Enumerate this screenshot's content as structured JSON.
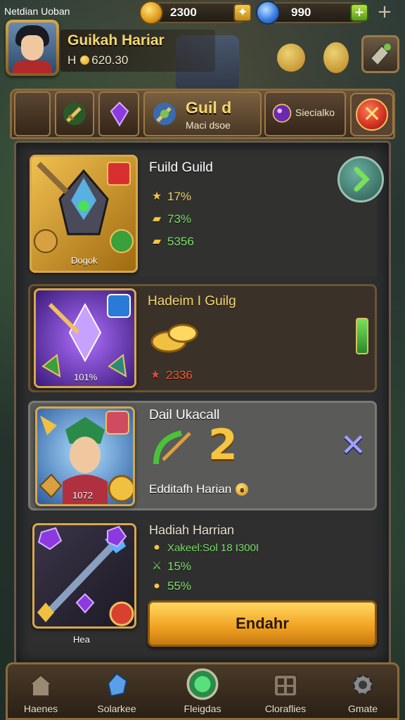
{
  "status_bar": {
    "title": "Netdian Uoban"
  },
  "resources": {
    "gold": {
      "value": "2300",
      "icon": "gold-coin-icon"
    },
    "gems": {
      "value": "990",
      "icon": "blue-gem-icon"
    }
  },
  "player": {
    "name": "Guikah Hariar",
    "sub_prefix": "H",
    "coins": "620.30"
  },
  "tabs": {
    "active_title": "Guil d",
    "active_subtitle": "Maci dsoe",
    "side_label": "Siecialko"
  },
  "cards": [
    {
      "title": "Fuild Guild",
      "caption": "Dogok",
      "stats": [
        "17%",
        "73%",
        "5356"
      ]
    },
    {
      "title": "Hadeim I Guilg",
      "caption": "101%",
      "stats": [
        "2336"
      ]
    },
    {
      "title": "Dail Ukacall",
      "caption": "1072",
      "footer": "Edditafh Harian"
    },
    {
      "title": "Hadiah Harrian",
      "caption": "Hea",
      "stats": [
        "Xakeel:Sol 18 I300I",
        "15%",
        "55%"
      ],
      "button": "Endahr"
    }
  ],
  "bottom_nav": [
    {
      "label": "Haenes",
      "icon": "house-icon"
    },
    {
      "label": "Solarkee",
      "icon": "crystal-icon"
    },
    {
      "label": "Fleigdas",
      "icon": "green-orb-icon"
    },
    {
      "label": "Cloraflies",
      "icon": "inventory-grid-icon"
    },
    {
      "label": "Gmate",
      "icon": "gear-icon"
    }
  ],
  "colors": {
    "accent_gold": "#f5d76e",
    "stat_green": "#7ee06a",
    "panel_bg": "#2c2e30",
    "frame_brown": "#8a6a3e"
  }
}
